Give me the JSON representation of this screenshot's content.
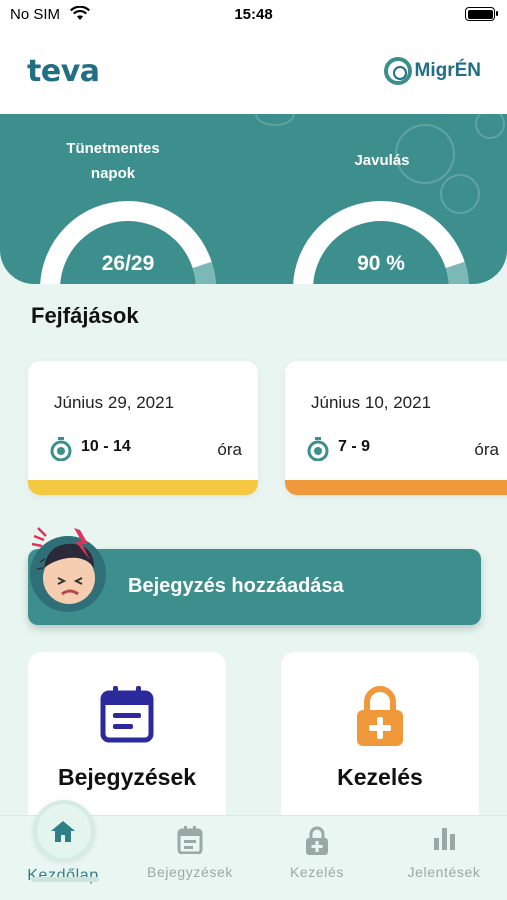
{
  "status_bar": {
    "carrier": "No SIM",
    "time": "15:48"
  },
  "header": {
    "brand_logo": "teva",
    "app_logo": "MigrÉN"
  },
  "stats": [
    {
      "label_line1": "Tünetmentes",
      "label_line2": "napok",
      "value": "26/29",
      "progress": 0.9
    },
    {
      "label_line1": "Javulás",
      "label_line2": "",
      "value": "90 %",
      "progress": 0.9
    }
  ],
  "headaches": {
    "title": "Fejfájások",
    "cards": [
      {
        "date": "Június 29, 2021",
        "range": "10 - 14",
        "unit": "óra",
        "color": "#f5c842"
      },
      {
        "date": "Június 10, 2021",
        "range": "7 - 9",
        "unit": "óra",
        "color": "#f0993a"
      }
    ]
  },
  "add_entry": {
    "label": "Bejegyzés hozzáadása"
  },
  "tiles": [
    {
      "label": "Bejegyzések",
      "icon": "calendar-icon",
      "color": "#2b2a9c"
    },
    {
      "label": "Kezelés",
      "icon": "lock-plus-icon",
      "color": "#f0993a"
    }
  ],
  "tabbar": [
    {
      "label": "Kezdőlap",
      "icon": "home-icon",
      "active": true
    },
    {
      "label": "Bejegyzések",
      "icon": "calendar-icon",
      "active": false
    },
    {
      "label": "Kezelés",
      "icon": "lock-plus-icon",
      "active": false
    },
    {
      "label": "Jelentések",
      "icon": "bar-chart-icon",
      "active": false
    }
  ],
  "colors": {
    "primary": "#3d8f8e",
    "background": "#e8f5f0",
    "accent_yellow": "#f5c842",
    "accent_orange": "#f0993a"
  }
}
